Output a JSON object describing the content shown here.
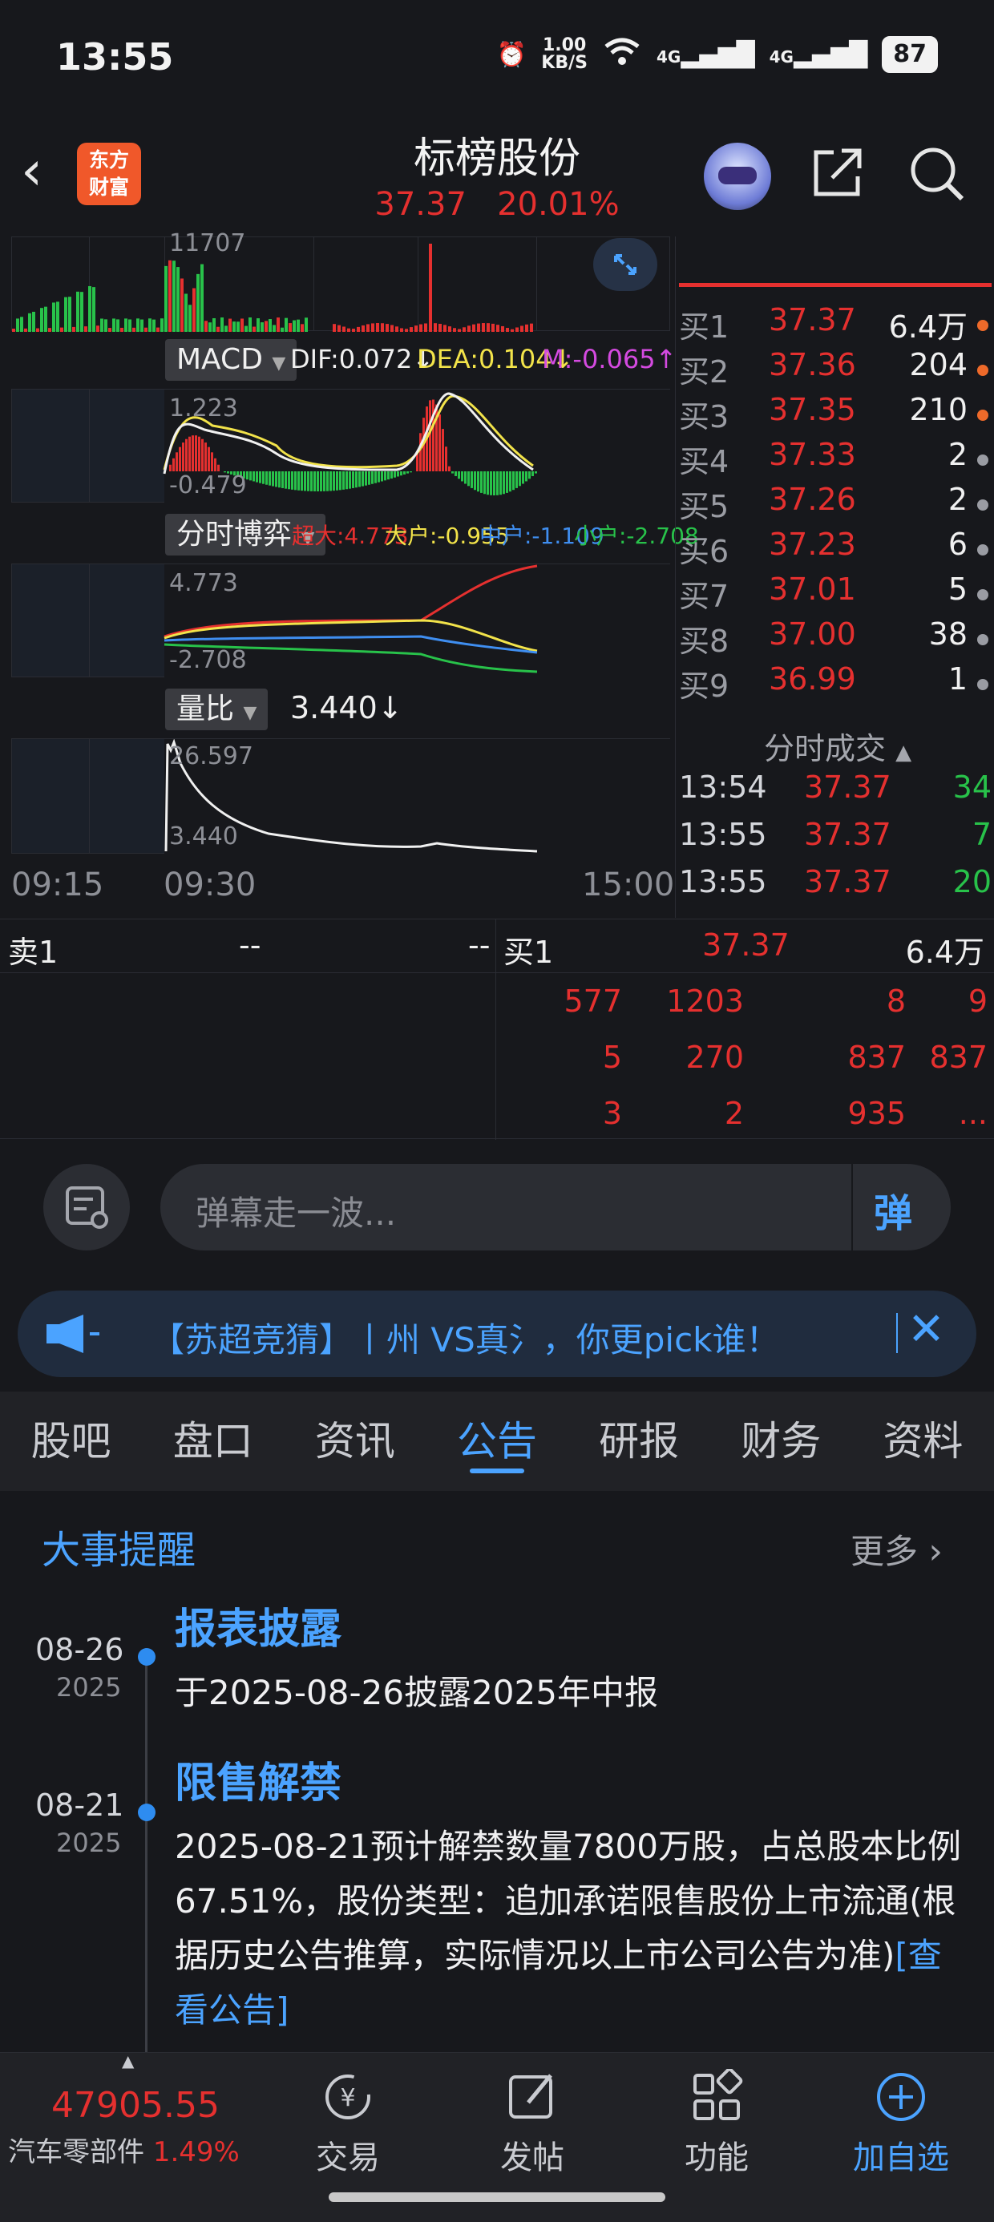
{
  "status_bar": {
    "time": "13:55",
    "net_speed_value": "1.00",
    "net_speed_unit": "KB/S",
    "signal1": "4G",
    "signal2": "4G",
    "battery": "87"
  },
  "header": {
    "logo_line1": "东方",
    "logo_line2": "财富",
    "title": "标榜股份",
    "price": "37.37",
    "change_pct": "20.01%"
  },
  "chart": {
    "volume_label": "11707",
    "macd": {
      "name": "MACD",
      "dif": "DIF:0.072↓",
      "dea": "DEA:0.104↓",
      "m": "M:-0.065↑",
      "max": "1.223",
      "min": "-0.479"
    },
    "boyi": {
      "name": "分时博弈",
      "chaoda": "超大:4.773",
      "dahu": "大户:-0.955",
      "zhonghu": "中户:-1.109",
      "xiaohu": "小户:-2.708",
      "max": "4.773",
      "min": "-2.708"
    },
    "liangbi": {
      "name": "量比",
      "value": "3.440↓",
      "max": "26.597",
      "min": "3.440"
    },
    "times": [
      "09:15",
      "09:30",
      "15:00"
    ]
  },
  "order_book": {
    "bids": [
      {
        "label": "买1",
        "price": "37.37",
        "volume": "6.4万",
        "dot": "#ee6a2a"
      },
      {
        "label": "买2",
        "price": "37.36",
        "volume": "204",
        "dot": "#ee6a2a"
      },
      {
        "label": "买3",
        "price": "37.35",
        "volume": "210",
        "dot": "#ee6a2a"
      },
      {
        "label": "买4",
        "price": "37.33",
        "volume": "2",
        "dot": "#9a9ca3"
      },
      {
        "label": "买5",
        "price": "37.26",
        "volume": "2",
        "dot": "#9a9ca3"
      },
      {
        "label": "买6",
        "price": "37.23",
        "volume": "6",
        "dot": "#9a9ca3"
      },
      {
        "label": "买7",
        "price": "37.01",
        "volume": "5",
        "dot": "#9a9ca3"
      },
      {
        "label": "买8",
        "price": "37.00",
        "volume": "38",
        "dot": "#9a9ca3"
      },
      {
        "label": "买9",
        "price": "36.99",
        "volume": "1",
        "dot": "#9a9ca3"
      }
    ],
    "ticks_title": "分时成交",
    "ticks": [
      {
        "time": "13:54",
        "price": "37.37",
        "volume": "34"
      },
      {
        "time": "13:55",
        "price": "37.37",
        "volume": "7"
      },
      {
        "time": "13:55",
        "price": "37.37",
        "volume": "20"
      }
    ]
  },
  "level2": {
    "sell1_label": "卖1",
    "sell1_price": "--",
    "sell1_volume": "--",
    "buy1_label": "买1",
    "buy1_price": "37.37",
    "buy1_volume": "6.4万",
    "queue": [
      [
        "577",
        "1203",
        "8",
        "9"
      ],
      [
        "5",
        "270",
        "837",
        "837"
      ],
      [
        "3",
        "2",
        "935",
        "..."
      ]
    ]
  },
  "danmu": {
    "placeholder": "弹幕走一波...",
    "button": "弹"
  },
  "notice": {
    "text": "【苏超竞猜】丨州 VS真氵，你更pick谁！"
  },
  "tabs": [
    "股吧",
    "盘口",
    "资讯",
    "公告",
    "研报",
    "财务",
    "资料"
  ],
  "active_tab": "公告",
  "events": {
    "title": "大事提醒",
    "more": "更多",
    "items": [
      {
        "date": "08-26",
        "year": "2025",
        "title": "报表披露",
        "body": "于2025-08-26披露2025年中报",
        "link": ""
      },
      {
        "date": "08-21",
        "year": "2025",
        "title": "限售解禁",
        "body": "2025-08-21预计解禁数量7800万股，占总股本比例67.51%，股份类型：追加承诺限售股份上市流通(根据历史公告推算，实际情况以上市公司公告为准)",
        "link": "[查看公告]"
      }
    ]
  },
  "bottom_nav": {
    "index_value": "47905.55",
    "index_name": "汽车零部件",
    "index_change": "1.49%",
    "items": [
      "交易",
      "发帖",
      "功能",
      "加自选"
    ]
  },
  "colors": {
    "up": "#e5302f",
    "down": "#28c24a",
    "accent": "#4ba3ff",
    "dif": "#f0f0f0",
    "dea": "#f2e34a",
    "m": "#d44ae0",
    "dahu": "#f2e34a",
    "zhonghu": "#3f8ef0",
    "xiaohu": "#28c24a"
  }
}
